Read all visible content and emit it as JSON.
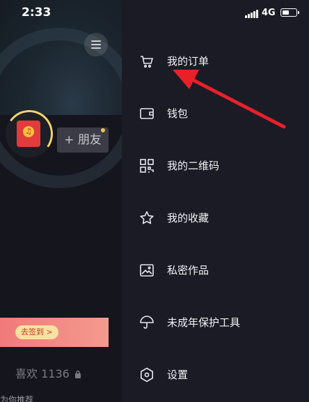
{
  "status_bar": {
    "time": "2:33",
    "network": "4G",
    "battery_level": 0.55
  },
  "profile": {
    "friend_button": "+ 朋友",
    "checkin_big": "礼",
    "checkin_label": "去签到 >",
    "likes_label": "喜欢 1136",
    "bottom_snippet": "为你推荐"
  },
  "drawer": {
    "items": [
      {
        "label": "我的订单",
        "icon": "cart-icon"
      },
      {
        "label": "钱包",
        "icon": "wallet-icon"
      },
      {
        "label": "我的二维码",
        "icon": "qrcode-icon"
      },
      {
        "label": "我的收藏",
        "icon": "star-icon"
      },
      {
        "label": "私密作品",
        "icon": "private-image-icon"
      },
      {
        "label": "未成年保护工具",
        "icon": "umbrella-icon"
      },
      {
        "label": "设置",
        "icon": "settings-hexagon-icon"
      }
    ]
  },
  "colors": {
    "drawer_bg": "#1a1b25",
    "arrow": "#e8202a",
    "accent_gold": "#f4d36a"
  }
}
